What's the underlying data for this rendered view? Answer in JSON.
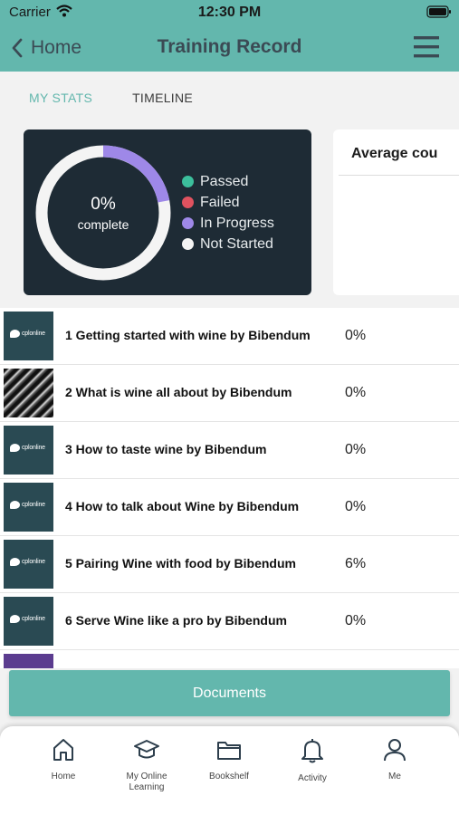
{
  "status_bar": {
    "carrier": "Carrier",
    "time": "12:30 PM"
  },
  "nav": {
    "back_label": "Home",
    "title": "Training Record"
  },
  "tabs": [
    {
      "label": "MY STATS",
      "active": true
    },
    {
      "label": "TIMELINE",
      "active": false
    }
  ],
  "stats": {
    "percent": "0%",
    "complete_label": "complete",
    "in_progress_fraction": 0.22,
    "legend": [
      {
        "label": "Passed",
        "color": "#3cbf9c"
      },
      {
        "label": "Failed",
        "color": "#e0525f"
      },
      {
        "label": "In Progress",
        "color": "#9e88e8"
      },
      {
        "label": "Not Started",
        "color": "#f4f4f4"
      }
    ]
  },
  "average_card": {
    "title": "Average cou"
  },
  "courses": [
    {
      "title": "1 Getting started with wine by Bibendum",
      "percent": "0%",
      "thumb": "logo-icon"
    },
    {
      "title": "2 What is wine all about by Bibendum",
      "percent": "0%",
      "thumb": "photo"
    },
    {
      "title": "3 How to taste wine by Bibendum",
      "percent": "0%",
      "thumb": "logo-icon"
    },
    {
      "title": "4 How to talk about Wine by Bibendum",
      "percent": "0%",
      "thumb": "logo-icon"
    },
    {
      "title": "5 Pairing Wine with food by Bibendum",
      "percent": "6%",
      "thumb": "logo-icon"
    },
    {
      "title": "6 Serve Wine like a pro by Bibendum",
      "percent": "0%",
      "thumb": "logo-icon"
    }
  ],
  "logo_text": "cplonline",
  "documents_button": "Documents",
  "tabbar": [
    {
      "label": "Home",
      "icon": "house-icon"
    },
    {
      "label": "My Online Learning",
      "icon": "graduation-cap-icon"
    },
    {
      "label": "Bookshelf",
      "icon": "folder-icon"
    },
    {
      "label": "Activity",
      "icon": "bell-icon"
    },
    {
      "label": "Me",
      "icon": "person-icon"
    }
  ],
  "colors": {
    "accent": "#63b7ad",
    "card_dark": "#1e2b35",
    "nav_text": "#3b4a54"
  }
}
